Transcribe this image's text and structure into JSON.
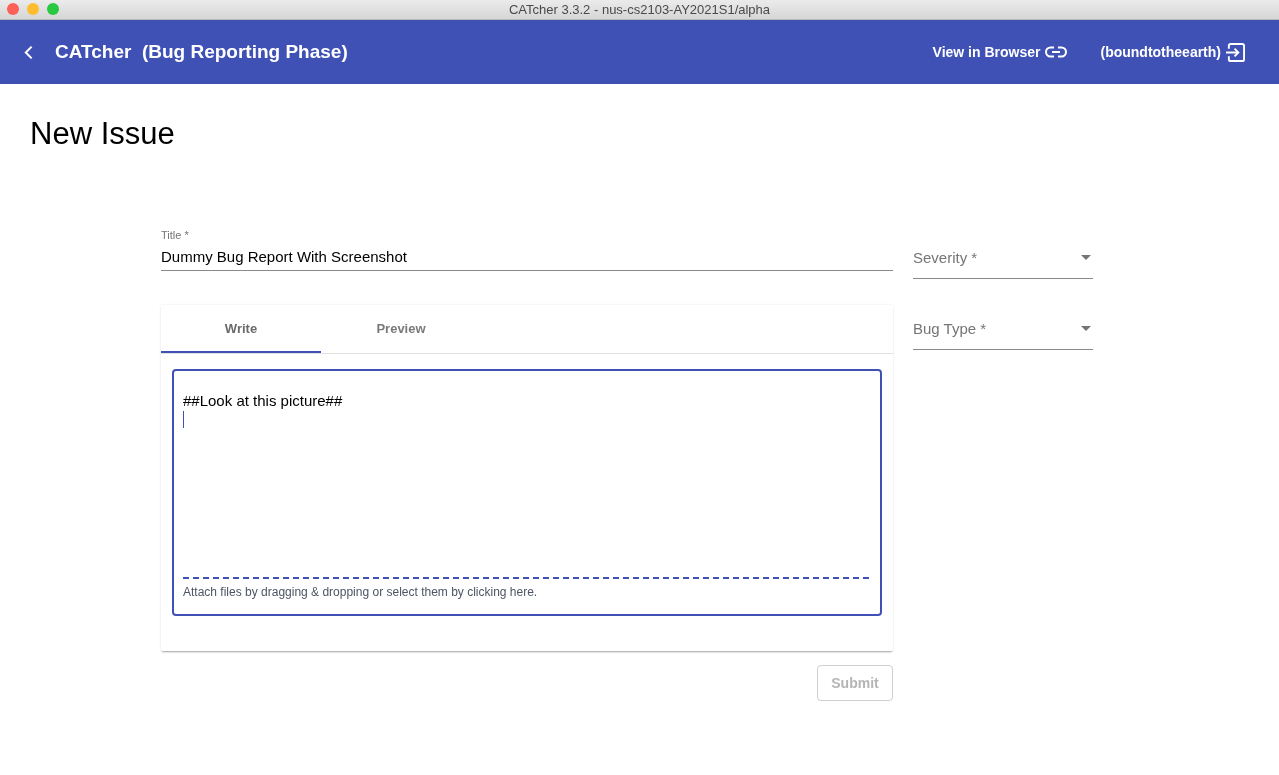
{
  "window": {
    "title": "CATcher 3.3.2 - nus-cs2103-AY2021S1/alpha"
  },
  "toolbar": {
    "title": "CATcher  (Bug Reporting Phase)",
    "actions": [
      {
        "label": "View in Browser",
        "kind": "link"
      },
      {
        "label": "(boundtotheearth)",
        "kind": "logout"
      }
    ]
  },
  "page": {
    "heading": "New Issue"
  },
  "form": {
    "title_field": {
      "label": "Title *",
      "value": "Dummy Bug Report With Screenshot"
    },
    "selects": [
      {
        "label": "Severity *"
      },
      {
        "label": "Bug Type *"
      }
    ],
    "editor": {
      "tabs": [
        {
          "label": "Write",
          "selected": true
        },
        {
          "label": "Preview",
          "selected": false
        }
      ],
      "value": "##Look at this picture##",
      "focused": true,
      "hint": "Attach files by dragging & dropping or select them by clicking here."
    },
    "submit": {
      "label": "Submit",
      "disabled": true
    }
  }
}
